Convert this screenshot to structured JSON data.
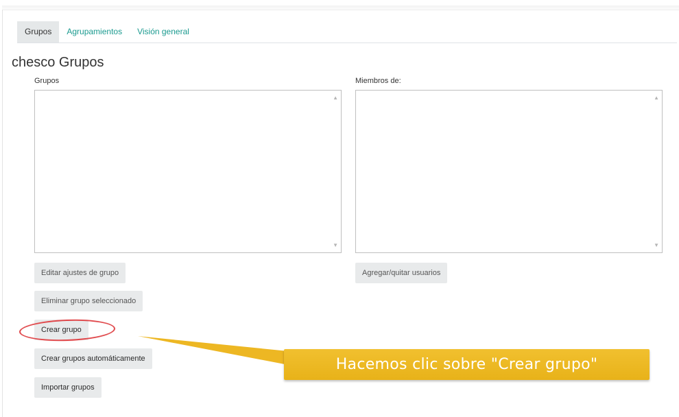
{
  "tabs": [
    {
      "label": "Grupos",
      "active": true
    },
    {
      "label": "Agrupamientos",
      "active": false
    },
    {
      "label": "Visión general",
      "active": false
    }
  ],
  "page_title": "chesco Grupos",
  "groups_column": {
    "label": "Grupos",
    "buttons": {
      "edit": "Editar ajustes de grupo",
      "delete": "Eliminar grupo seleccionado",
      "create": "Crear grupo",
      "auto_create": "Crear grupos automáticamente",
      "import": "Importar grupos"
    }
  },
  "members_column": {
    "label": "Miembros de:",
    "buttons": {
      "add_remove": "Agregar/quitar usuarios"
    }
  },
  "callout": {
    "text": "Hacemos clic sobre \"Crear grupo\"",
    "color": "#edb723",
    "highlight_color": "#e0484b"
  },
  "colors": {
    "accent": "#1a9a8f",
    "active_tab_bg": "#e5e8e9",
    "button_bg": "#e8eaeb"
  }
}
